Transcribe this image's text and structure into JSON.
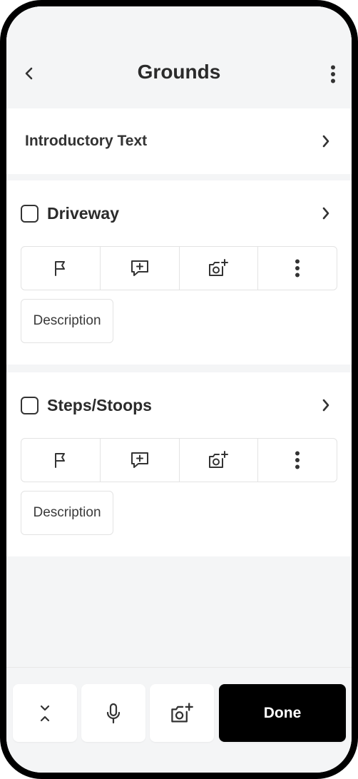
{
  "header": {
    "title": "Grounds",
    "back_icon": "chevron-left-icon",
    "menu_icon": "more-vertical-icon"
  },
  "intro": {
    "label": "Introductory Text",
    "icon": "chevron-right-icon"
  },
  "items": [
    {
      "title": "Driveway",
      "checked": false,
      "tools": [
        "flag-icon",
        "add-comment-icon",
        "add-photo-icon",
        "more-vertical-icon"
      ],
      "description_label": "Description"
    },
    {
      "title": "Steps/Stoops",
      "checked": false,
      "tools": [
        "flag-icon",
        "add-comment-icon",
        "add-photo-icon",
        "more-vertical-icon"
      ],
      "description_label": "Description"
    }
  ],
  "bottom_bar": {
    "collapse_icon": "collapse-icon",
    "mic_icon": "microphone-icon",
    "photo_icon": "add-photo-icon",
    "done_label": "Done"
  },
  "colors": {
    "background": "#f4f5f6",
    "card": "#ffffff",
    "text": "#2b2b2b",
    "done_button": "#000000"
  }
}
